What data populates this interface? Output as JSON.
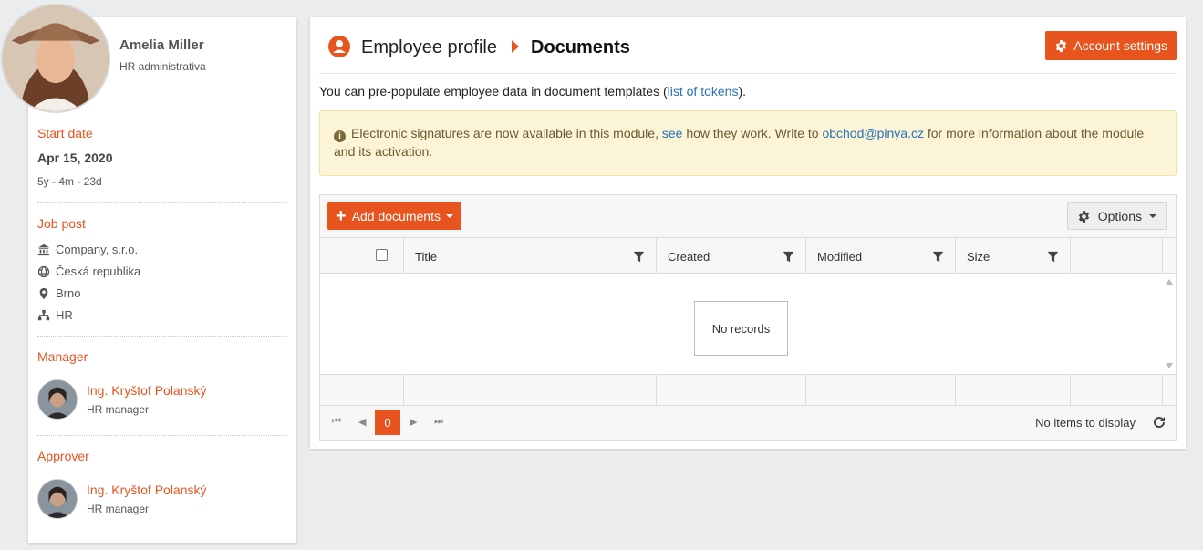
{
  "profile": {
    "name": "Amelia Miller",
    "role": "HR administrativa",
    "start_date_label": "Start date",
    "start_date": "Apr 15, 2020",
    "duration": "5y - 4m - 23d",
    "job_post_label": "Job post",
    "company": "Company, s.r.o.",
    "country": "Česká republika",
    "city": "Brno",
    "department": "HR",
    "manager_label": "Manager",
    "manager": {
      "name": "Ing. Kryštof Polanský",
      "role": "HR manager"
    },
    "approver_label": "Approver",
    "approver": {
      "name": "Ing. Kryštof Polanský",
      "role": "HR manager"
    }
  },
  "header": {
    "breadcrumb_parent": "Employee profile",
    "breadcrumb_current": "Documents",
    "account_settings": "Account settings"
  },
  "intro": {
    "text_before": "You can pre-populate employee data in document templates (",
    "link": "list of tokens",
    "text_after": ")."
  },
  "alert": {
    "text1": "Electronic signatures are now available in this module, ",
    "link1": "see",
    "text2": " how they work. Write to ",
    "email": "obchod@pinya.cz",
    "text3": " for more information about the module and its activation."
  },
  "grid": {
    "add_documents": "Add documents",
    "options": "Options",
    "columns": [
      "Title",
      "Created",
      "Modified",
      "Size"
    ],
    "empty": "No records",
    "current_page": "0",
    "status": "No items to display"
  },
  "colors": {
    "accent": "#e8541e",
    "link": "#2a72b5",
    "alert_bg": "#fbf4d6"
  }
}
